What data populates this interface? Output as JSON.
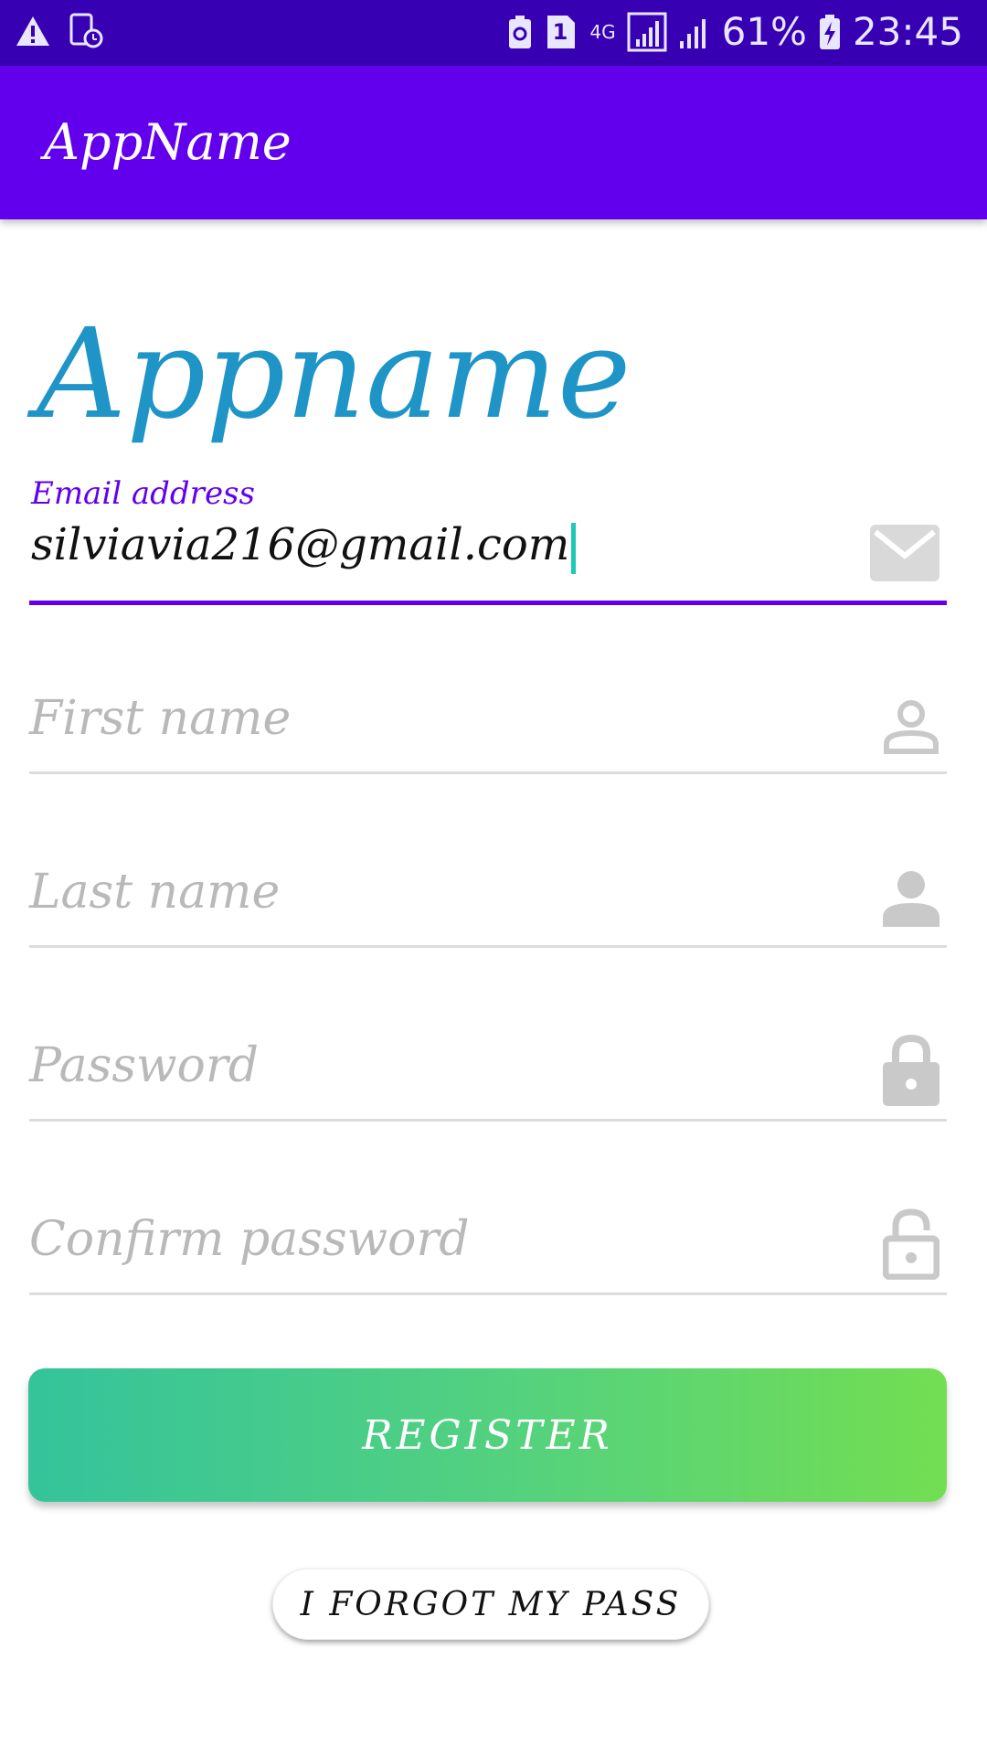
{
  "status_bar": {
    "battery_percent": "61%",
    "time": "23:45",
    "sim_badge": "1",
    "network": "4G",
    "icons": [
      "alert-icon",
      "clock-file-icon",
      "battery-saver-icon",
      "sim-icon",
      "network-4g-icon",
      "signal-icon",
      "signal-icon",
      "battery-charging-icon"
    ]
  },
  "app_bar": {
    "title": "AppName"
  },
  "hero": {
    "title": "Appname"
  },
  "form": {
    "email": {
      "label": "Email address",
      "value": "silviavia216@gmail.com",
      "icon": "email-icon"
    },
    "first_name": {
      "placeholder": "First name",
      "icon": "person-outline-icon"
    },
    "last_name": {
      "placeholder": "Last name",
      "icon": "person-icon"
    },
    "password": {
      "placeholder": "Password",
      "icon": "lock-icon"
    },
    "confirm_password": {
      "placeholder": "Confirm password",
      "icon": "lock-open-icon"
    }
  },
  "actions": {
    "register_label": "REGISTER",
    "forgot_label": "I FORGOT MY PASS"
  },
  "colors": {
    "status_bar": "#3700b3",
    "app_bar": "#6200ee",
    "hero_title": "#1f94c7",
    "register_gradient_start": "#34c39b",
    "register_gradient_end": "#73de52",
    "caret": "#1ec8b8",
    "placeholder": "#b9b9b9"
  }
}
